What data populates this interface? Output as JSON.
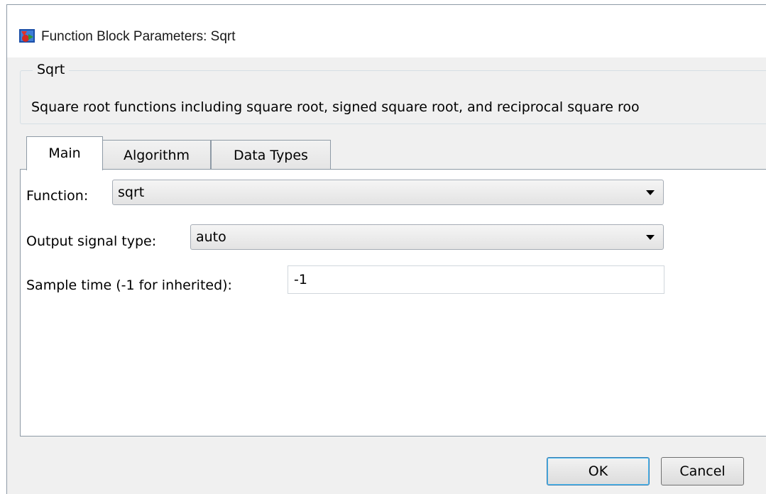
{
  "window": {
    "title": "Function Block Parameters: Sqrt",
    "icon": "simulink-block-icon"
  },
  "description": {
    "group_title": "Sqrt",
    "text": "Square root functions including square root, signed square root, and reciprocal square roo"
  },
  "tabs": [
    {
      "label": "Main",
      "active": true
    },
    {
      "label": "Algorithm",
      "active": false
    },
    {
      "label": "Data Types",
      "active": false
    }
  ],
  "params": {
    "function": {
      "label": "Function:",
      "value": "sqrt"
    },
    "output_signal_type": {
      "label": "Output signal type:",
      "value": "auto"
    },
    "sample_time": {
      "label": "Sample time (-1 for inherited):",
      "value": "-1"
    }
  },
  "buttons": {
    "ok": "OK",
    "cancel": "Cancel"
  }
}
